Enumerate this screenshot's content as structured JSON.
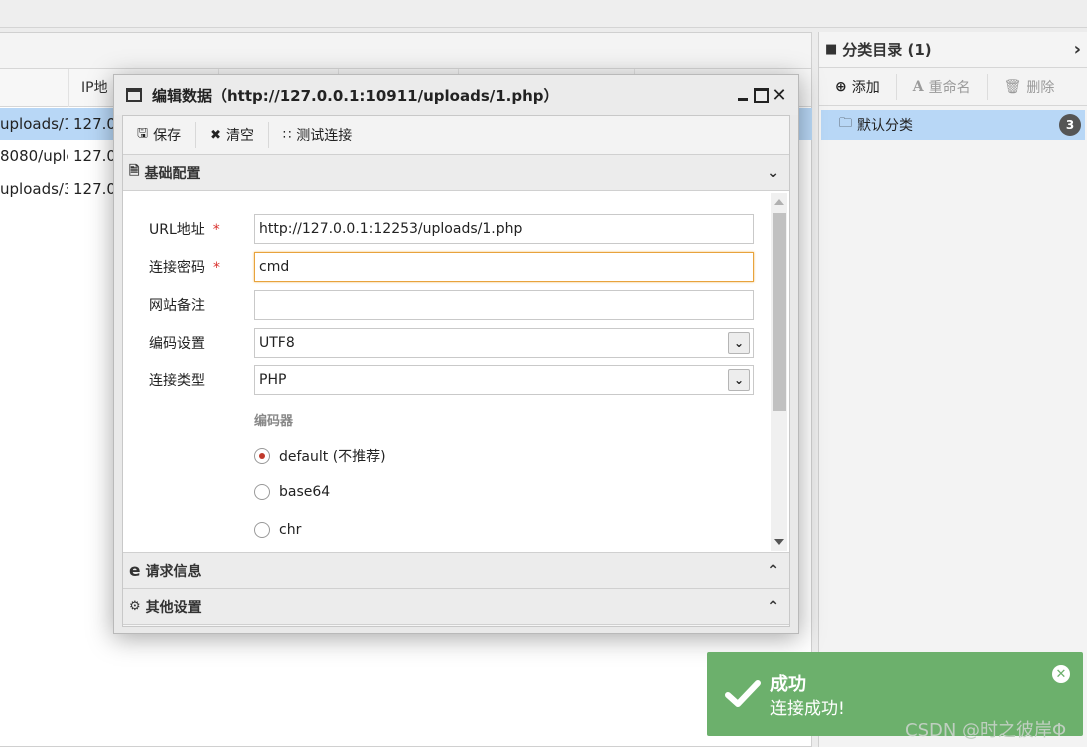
{
  "table": {
    "columns": [
      {
        "label": ""
      },
      {
        "label": "IP地"
      }
    ],
    "rows": [
      {
        "url": "uploads/1.",
        "ip": "127.0"
      },
      {
        "url": "8080/uplc",
        "ip": "127.0"
      },
      {
        "url": "uploads/3.",
        "ip": "127.0"
      }
    ]
  },
  "category_panel": {
    "title": "分类目录 (1)",
    "toolbar": {
      "add": "添加",
      "rename": "重命名",
      "delete": "删除"
    },
    "items": [
      {
        "label": "默认分类",
        "count": "3"
      }
    ]
  },
  "dialog": {
    "title": "编辑数据（http://127.0.0.1:10911/uploads/1.php）",
    "toolbar": {
      "save": "保存",
      "clear": "清空",
      "test": "测试连接"
    },
    "sections": {
      "basic": "基础配置",
      "request": "请求信息",
      "other": "其他设置"
    },
    "form": {
      "url_label": "URL地址",
      "url_value": "http://127.0.0.1:12253/uploads/1.php",
      "password_label": "连接密码",
      "password_value": "cmd",
      "note_label": "网站备注",
      "note_value": "",
      "encoding_label": "编码设置",
      "encoding_value": "UTF8",
      "type_label": "连接类型",
      "type_value": "PHP",
      "required_mark": "*",
      "encoder_label": "编码器",
      "encoders": [
        {
          "label": "default (不推荐)",
          "checked": true
        },
        {
          "label": "base64",
          "checked": false
        },
        {
          "label": "chr",
          "checked": false
        }
      ]
    }
  },
  "toast": {
    "title": "成功",
    "message": "连接成功!",
    "color": "#6cb06c"
  },
  "watermark": "CSDN @时之彼岸Φ",
  "colors": {
    "selection": "#b8d7f6",
    "required": "#d9302c",
    "focus_border": "#e8a33c"
  }
}
